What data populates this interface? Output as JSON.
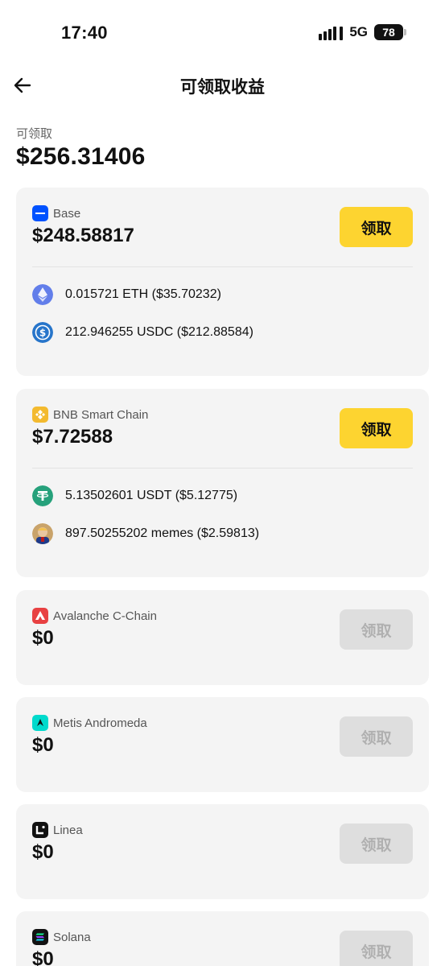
{
  "status_bar": {
    "time": "17:40",
    "network": "5G",
    "battery": "78"
  },
  "header": {
    "title": "可领取收益"
  },
  "summary": {
    "label": "可领取",
    "amount": "$256.31406"
  },
  "claim_label": "领取",
  "chains": [
    {
      "name": "Base",
      "amount": "$248.58817",
      "active": true,
      "logo": "base-logo",
      "logo_color": "#0052ff",
      "tokens": [
        {
          "icon": "eth-icon",
          "text": "0.015721 ETH ($35.70232)"
        },
        {
          "icon": "usdc-icon",
          "text": "212.946255 USDC ($212.88584)"
        }
      ]
    },
    {
      "name": "BNB Smart Chain",
      "amount": "$7.72588",
      "active": true,
      "logo": "bnb-logo",
      "logo_color": "#f3ba2f",
      "tokens": [
        {
          "icon": "usdt-icon",
          "text": "5.13502601 USDT ($5.12775)"
        },
        {
          "icon": "memes-icon",
          "text": "897.50255202 memes ($2.59813)"
        }
      ]
    },
    {
      "name": "Avalanche C-Chain",
      "amount": "$0",
      "active": false,
      "logo": "avalanche-logo",
      "logo_color": "#e84142"
    },
    {
      "name": "Metis Andromeda",
      "amount": "$0",
      "active": false,
      "logo": "metis-logo",
      "logo_color": "#00dacc"
    },
    {
      "name": "Linea",
      "amount": "$0",
      "active": false,
      "logo": "linea-logo",
      "logo_color": "#121212"
    },
    {
      "name": "Solana",
      "amount": "$0",
      "active": false,
      "logo": "solana-logo",
      "logo_color": "#121212"
    }
  ]
}
